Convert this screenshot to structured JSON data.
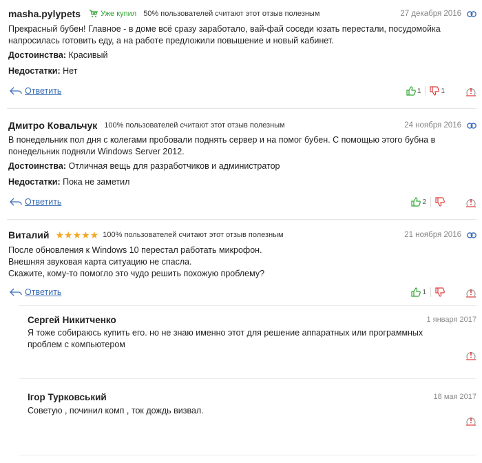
{
  "reviews": [
    {
      "author": "masha.pylypets",
      "bought": "Уже купил",
      "useful": "50% пользователей считают этот отзыв полезным",
      "date": "27 декабря 2016",
      "text": "Прекрасный бубен! Главное - в доме всё сразу заработало, вай-фай соседи юзать перестали, посудомойка напросилась готовить еду, а на работе предложили повышение и новый кабинет.",
      "pros_label": "Достоинства:",
      "pros": "Красивый",
      "cons_label": "Недостатки:",
      "cons": "Нет",
      "reply": "Ответить",
      "likes": "1",
      "dislikes": "1"
    },
    {
      "author": "Дмитро Ковальчук",
      "useful": "100% пользователей считают этот отзыв полезным",
      "date": "24 ноября 2016",
      "text": "В понедельник пол дня с колегами пробовали поднять сервер и на помог бубен. С помощью этого бубна в понедельник подняли Windows Server 2012.",
      "pros_label": "Достоинства:",
      "pros": "Отличная вещь для разработчиков и администратор",
      "cons_label": "Недостатки:",
      "cons": "Пока не заметил",
      "reply": "Ответить",
      "likes": "2"
    },
    {
      "author": "Виталий",
      "rating": 5,
      "useful": "100% пользователей считают этот отзыв полезным",
      "date": "21 ноября 2016",
      "text_lines": [
        "После обновления к Windows 10 перестал работать микрофон.",
        "Внешняя звуковая карта ситуацию не спасла.",
        "Скажите, кому-то помогло это чудо решить похожую проблему?"
      ],
      "reply": "Ответить",
      "likes": "1"
    }
  ],
  "comments": [
    {
      "author": "Сергей Никитченко",
      "date": "1 января 2017",
      "text": "Я тоже собираюсь купить его. но не знаю именно этот для решение аппаратных или программных проблем с компьютером"
    },
    {
      "author": "Ігор Турковський",
      "date": "18 мая 2017",
      "text": "Советую , починил комп , ток дождь визвал."
    }
  ],
  "colors": {
    "link": "#3b6fb6",
    "bought": "#2ea52e",
    "like": "#2ea52e",
    "dislike": "#e03a3a",
    "star": "#f5a623"
  },
  "icons": [
    "cart-check-icon",
    "link-chain-icon",
    "reply-arrow-icon",
    "thumb-up-icon",
    "thumb-down-icon",
    "report-warning-icon",
    "star-icon"
  ]
}
